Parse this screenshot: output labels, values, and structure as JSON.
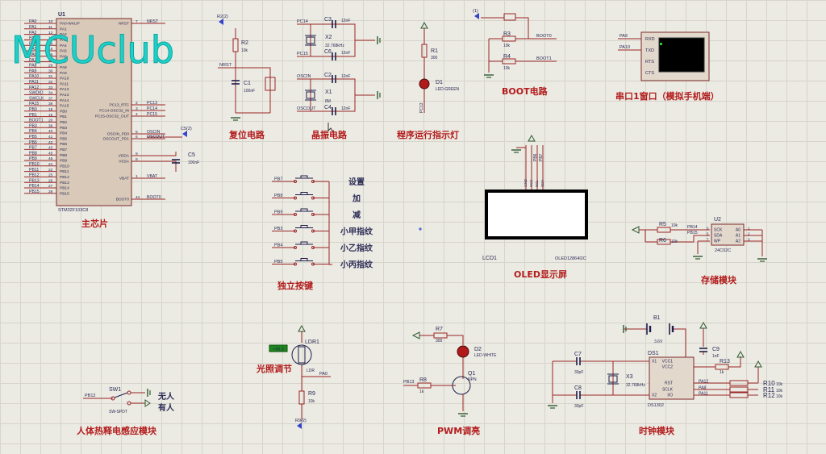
{
  "watermark": "MCUclub",
  "mcu": {
    "ref": "U1",
    "part": "STM32F103C8",
    "left_pins": [
      [
        "PA0",
        "10"
      ],
      [
        "PA1",
        "11"
      ],
      [
        "PA2",
        "12"
      ],
      [
        "PA3",
        "13"
      ],
      [
        "PA4",
        "14"
      ],
      [
        "PA5",
        "15"
      ],
      [
        "PA6",
        "16"
      ],
      [
        "PA7",
        "17"
      ],
      [
        "PA8",
        "29"
      ],
      [
        "PA9",
        "30"
      ],
      [
        "PA10",
        "31"
      ],
      [
        "PA11",
        "32"
      ],
      [
        "PA12",
        "33"
      ],
      [
        "SWDIO",
        "34"
      ],
      [
        "SWCLK",
        "37"
      ],
      [
        "PA15",
        "38"
      ],
      [
        "PB0",
        "18"
      ],
      [
        "PB1",
        "19"
      ],
      [
        "BOOT1",
        "20"
      ],
      [
        "PB3",
        "39"
      ],
      [
        "PB4",
        "40"
      ],
      [
        "PB5",
        "41"
      ],
      [
        "PB6",
        "42"
      ],
      [
        "PB7",
        "43"
      ],
      [
        "PB8",
        "45"
      ],
      [
        "PB9",
        "46"
      ],
      [
        "PB10",
        "21"
      ],
      [
        "PB11",
        "22"
      ],
      [
        "PB12",
        "25"
      ],
      [
        "PB13",
        "26"
      ],
      [
        "PB14",
        "27"
      ],
      [
        "PB15",
        "28"
      ]
    ],
    "inner_left": [
      "PA0-WKUP",
      "PA1",
      "PA2",
      "PA3",
      "PA4",
      "PA5",
      "PA6",
      "PA7",
      "PA8",
      "PA9",
      "PA10",
      "PA11",
      "PA12",
      "PA13",
      "PA14",
      "PA15",
      "PB0",
      "PB1",
      "PB2",
      "PB3",
      "PB4",
      "PB5",
      "PB6",
      "PB7",
      "PB8",
      "PB9",
      "PB10",
      "PB11",
      "PB12",
      "PB13",
      "PB14",
      "PB15"
    ],
    "right_pins": [
      [
        "NRST",
        "7",
        "NRST"
      ],
      [
        "PC13_RTC",
        "2",
        "PC13"
      ],
      [
        "PC14-OSC32_IN",
        "3",
        "PC14"
      ],
      [
        "PC15-OSC32_OUT",
        "4",
        "PC15"
      ],
      [
        "OSCIN_PD0",
        "5",
        "OSCIN"
      ],
      [
        "OSCOUT_PD1",
        "6",
        "OSCOUT"
      ],
      [
        "VDDA",
        "9",
        ""
      ],
      [
        "VSSA",
        "8",
        ""
      ],
      [
        "VBAT",
        "1",
        "VBAT"
      ],
      [
        "BOOT0",
        "44",
        "BOOT0"
      ]
    ],
    "title": "主芯片"
  },
  "reset": {
    "title": "复位电路",
    "r": "R2",
    "r_val": "10k",
    "c": "C1",
    "c_val": "100nF",
    "net": "NRST",
    "probe": "R2(2)"
  },
  "crystal": {
    "title": "晶振电路",
    "c3": "C3",
    "c6": "C6",
    "c2": "C2",
    "c4": "C4",
    "cap_val": "12nF",
    "x2": "X2",
    "x2_val": "32.768kHz",
    "x1": "X1",
    "x1_val": "8M",
    "nets": [
      "PC14",
      "PC15",
      "OSCIN",
      "OSCOUT"
    ]
  },
  "led_run": {
    "title": "程序运行指示灯",
    "r": "R1",
    "r_val": "300",
    "d": "D1",
    "d_val": "LED-GREEN",
    "net": "PC13"
  },
  "boot": {
    "title": "BOOT电路",
    "r3": "R3",
    "r4": "R4",
    "r_val": "10k",
    "nets": [
      "BOOT0",
      "BOOT1"
    ],
    "probe": "(1)"
  },
  "uart": {
    "title": "串口1窗口（模拟手机端）",
    "pins_left": [
      "PA9",
      "PA10"
    ],
    "pins": [
      "RXD",
      "TXD",
      "RTS",
      "CTS"
    ]
  },
  "cap5": {
    "name": "C5",
    "val": "100nF",
    "probe": "C5(2)"
  },
  "keys": {
    "title": "独立按键",
    "nets": [
      "PB7",
      "PB8",
      "PB9",
      "PB3",
      "PB4",
      "PB5"
    ],
    "labels": [
      "设置",
      "加",
      "减",
      "小甲指纹",
      "小乙指纹",
      "小丙指纹"
    ]
  },
  "oled": {
    "title": "OLED显示屏",
    "ref": "LCD1",
    "part": "OLED12864I2C",
    "pins": [
      "GND",
      "VCC",
      "SCL",
      "SDA"
    ],
    "nets": [
      "PB6",
      "PB7"
    ]
  },
  "eeprom": {
    "title": "存储模块",
    "ref": "U2",
    "part": "24C02C",
    "r5": "R5",
    "r6": "R6",
    "r_val": "10k",
    "nets": [
      "PB14",
      "PB15"
    ],
    "pins": [
      [
        "SCK",
        "A0",
        "6",
        "1"
      ],
      [
        "SDA",
        "A1",
        "5",
        "2"
      ],
      [
        "WP",
        "A2",
        "7",
        "3"
      ]
    ]
  },
  "ldr": {
    "title": "光照调节",
    "ref": "LDR1",
    "part": "LDR",
    "r": "R9",
    "r_val": "10k",
    "net": "PA0",
    "readout": "+88.8",
    "probe": "R9(2)"
  },
  "pwm": {
    "title": "PWM调亮",
    "r7": "R7",
    "r7_val": "300",
    "d2": "D2",
    "d2_val": "LED-WHITE",
    "r8": "R8",
    "r8_val": "1k",
    "q": "Q1",
    "q_val": "NPN",
    "net": "PB13"
  },
  "rtc": {
    "title": "时钟模块",
    "b1": "B1",
    "b1_val": "3.6V",
    "c9": "C9",
    "c9_val": "1nF",
    "r13": "R13",
    "r13_val": "1k",
    "c7": "C7",
    "c8": "C8",
    "c_val": "30pF",
    "x3": "X3",
    "x3_val": "32.768kHz",
    "ds": "DS1",
    "ds_part": "DS1302",
    "ds_pins": [
      [
        "X1",
        "VCC1",
        "2",
        "8"
      ],
      [
        "",
        "VCC2",
        "",
        "1"
      ],
      [
        "X2",
        "RST",
        "3",
        "5"
      ],
      [
        "",
        "SCLK",
        "",
        "7"
      ],
      [
        "",
        "I/O",
        "",
        "6"
      ]
    ],
    "nets": [
      "PA12",
      "PA8",
      "PA11"
    ],
    "rs": [
      "R10",
      "R11",
      "R12"
    ],
    "rs_val": "10k"
  },
  "pir": {
    "title": "人体热释电感应模块",
    "ref": "SW1",
    "part": "SW-SPDT",
    "net": "PB12",
    "states": [
      "无人",
      "有人"
    ]
  }
}
